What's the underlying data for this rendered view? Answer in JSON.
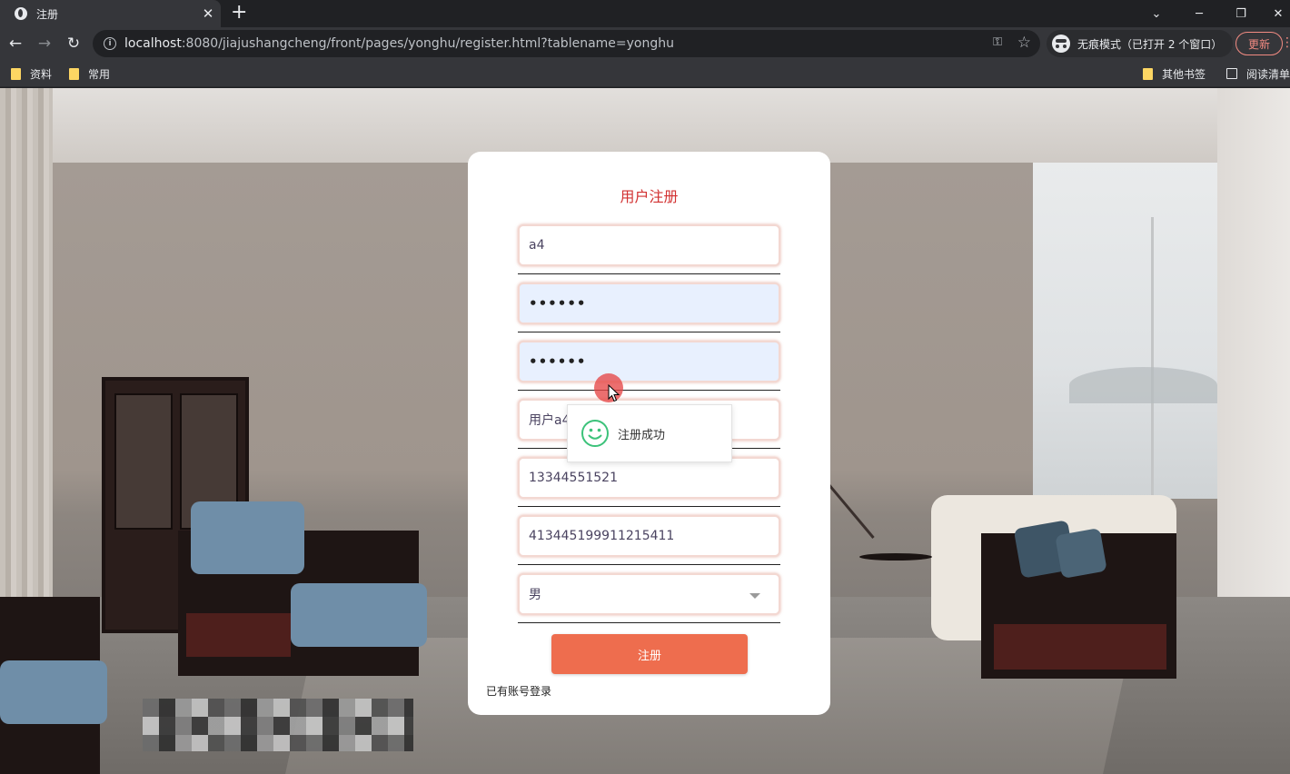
{
  "browser": {
    "tab_title": "注册",
    "tab_close": "✕",
    "new_tab": "+",
    "window_controls": {
      "minimize": "─",
      "restore": "❐",
      "close": "✕",
      "tab_search": "⌄"
    },
    "url_host": "localhost",
    "url_rest": ":8080/jiajushangcheng/front/pages/yonghu/register.html?tablename=yonghu",
    "incognito_label": "无痕模式（已打开 2 个窗口）",
    "update_label": "更新",
    "bookmarks": [
      "资料",
      "常用"
    ],
    "other_bookmarks": "其他书签",
    "reading_list": "阅读清单"
  },
  "form": {
    "title": "用户注册",
    "account_value": "a4",
    "password_mask": "••••••",
    "confirm_mask": "••••••",
    "name_value": "用户a4",
    "phone_value": "13344551521",
    "id_card_value": "413445199911215411",
    "gender_value": "男",
    "submit_label": "注册",
    "login_link": "已有账号登录"
  },
  "toast": {
    "message": "注册成功",
    "icon": "smile-icon"
  },
  "colors": {
    "title_red": "#d23131",
    "button_orange": "#ee6d4e",
    "toast_icon_green": "#3cc27a"
  }
}
